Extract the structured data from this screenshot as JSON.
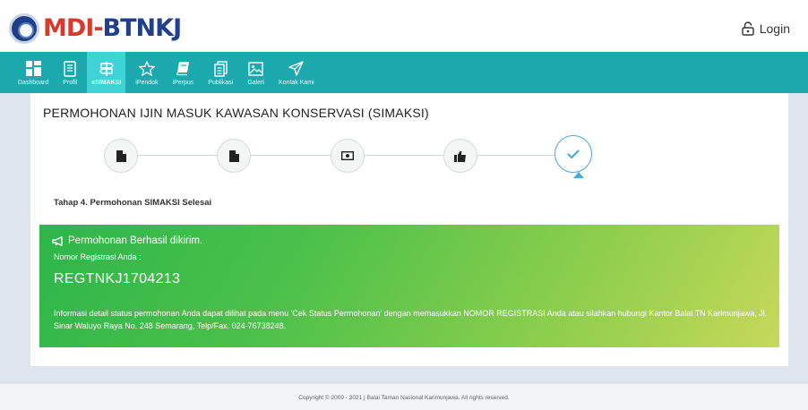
{
  "header": {
    "logo_text_a": "MDI-",
    "logo_text_b": "BTNKJ",
    "login_label": "Login"
  },
  "nav": {
    "items": [
      {
        "label": "Dashboard",
        "icon": "dashboard-icon"
      },
      {
        "label": "Profil",
        "icon": "document-icon"
      },
      {
        "label": "eSIMAKSI",
        "icon": "signpost-icon",
        "active": true
      },
      {
        "label": "iPendok",
        "icon": "star-icon"
      },
      {
        "label": "iPerpus",
        "icon": "book-icon"
      },
      {
        "label": "Publikasi",
        "icon": "files-icon"
      },
      {
        "label": "Galeri",
        "icon": "image-icon"
      },
      {
        "label": "Kontak Kami",
        "icon": "paper-plane-icon"
      }
    ]
  },
  "main": {
    "title": "PERMOHONAN IJIN MASUK KAWASAN KONSERVASI (SIMAKSI)",
    "steps": [
      {
        "icon": "file-icon"
      },
      {
        "icon": "file-icon"
      },
      {
        "icon": "money-icon"
      },
      {
        "icon": "thumbs-up-icon"
      },
      {
        "icon": "check-icon",
        "active": true
      }
    ],
    "stage_label": "Tahap 4. Permohonan SIMAKSI Selesai",
    "alert": {
      "heading": "Permohonan Berhasil dikirim.",
      "reg_label": "Nomor Registrasi Anda :",
      "reg_number": "REGTNKJ1704213",
      "info": "Informasi detail status permohonan Anda dapat dilihat pada menu 'Cek Status Permohonan' dengan memasukkan NOMOR REGISTRASI Anda atau silahkan hubungi Kantor Balai TN Karimunjawa, Jl. Sinar Waluyo Raya No. 248 Semarang, Telp/Fax. 024-76738248."
    }
  },
  "footer": {
    "copyright": "Copyright © 2009 - 2021 | Balai Taman Nasional Karimunjawa. All rights reserved."
  },
  "colors": {
    "nav_bg": "#1ba9ae",
    "nav_active": "#3fd2d6",
    "alert_start": "#2db64a",
    "alert_end": "#c7d85a",
    "step_active_border": "#46aadd"
  }
}
